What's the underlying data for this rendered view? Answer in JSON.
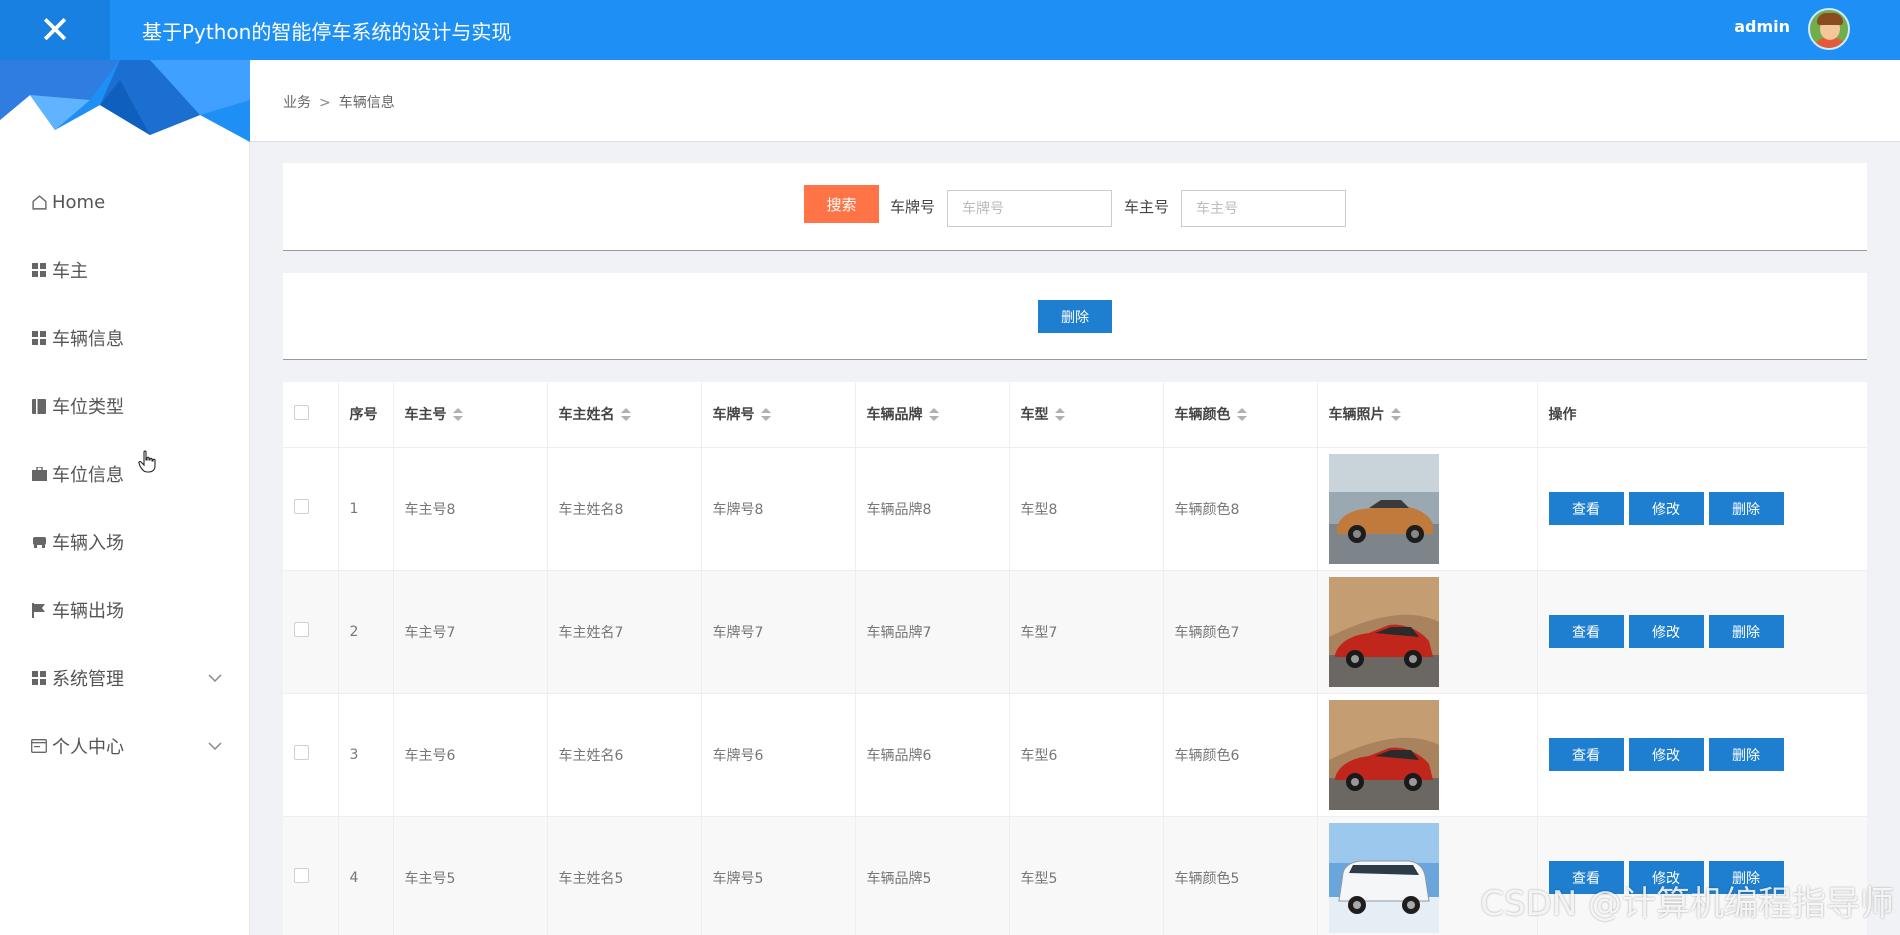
{
  "header": {
    "title": "基于Python的智能停车系统的设计与实现",
    "user": "admin",
    "brand_color": "#1e90f5"
  },
  "sidebar": {
    "items": [
      {
        "label": "Home",
        "icon": "home-icon"
      },
      {
        "label": "车主",
        "icon": "grid-icon"
      },
      {
        "label": "车辆信息",
        "icon": "grid-icon"
      },
      {
        "label": "车位类型",
        "icon": "book-icon"
      },
      {
        "label": "车位信息",
        "icon": "briefcase-icon"
      },
      {
        "label": "车辆入场",
        "icon": "car-icon"
      },
      {
        "label": "车辆出场",
        "icon": "flag-icon"
      },
      {
        "label": "系统管理",
        "icon": "grid-icon",
        "expandable": true
      },
      {
        "label": "个人中心",
        "icon": "id-card-icon",
        "expandable": true
      }
    ]
  },
  "breadcrumb": {
    "parent": "业务",
    "separator": ">",
    "current": "车辆信息"
  },
  "search": {
    "button": "搜索",
    "plate_label": "车牌号",
    "plate_placeholder": "车牌号",
    "owner_label": "车主号",
    "owner_placeholder": "车主号"
  },
  "actions": {
    "delete": "删除"
  },
  "table": {
    "columns": [
      "序号",
      "车主号",
      "车主姓名",
      "车牌号",
      "车辆品牌",
      "车型",
      "车辆颜色",
      "车辆照片",
      "操作"
    ],
    "buttons": {
      "view": "查看",
      "edit": "修改",
      "delete": "删除"
    },
    "rows": [
      {
        "index": "1",
        "owner_no": "车主号8",
        "owner_name": "车主姓名8",
        "plate": "车牌号8",
        "brand": "车辆品牌8",
        "model": "车型8",
        "color": "车辆颜色8",
        "photo": "orange-sports-car"
      },
      {
        "index": "2",
        "owner_no": "车主号7",
        "owner_name": "车主姓名7",
        "plate": "车牌号7",
        "brand": "车辆品牌7",
        "model": "车型7",
        "color": "车辆颜色7",
        "photo": "red-hatchback"
      },
      {
        "index": "3",
        "owner_no": "车主号6",
        "owner_name": "车主姓名6",
        "plate": "车牌号6",
        "brand": "车辆品牌6",
        "model": "车型6",
        "color": "车辆颜色6",
        "photo": "red-hatchback"
      },
      {
        "index": "4",
        "owner_no": "车主号5",
        "owner_name": "车主姓名5",
        "plate": "车牌号5",
        "brand": "车辆品牌5",
        "model": "车型5",
        "color": "车辆颜色5",
        "photo": "white-suv"
      }
    ]
  },
  "watermark": "CSDN @计算机编程指导师"
}
